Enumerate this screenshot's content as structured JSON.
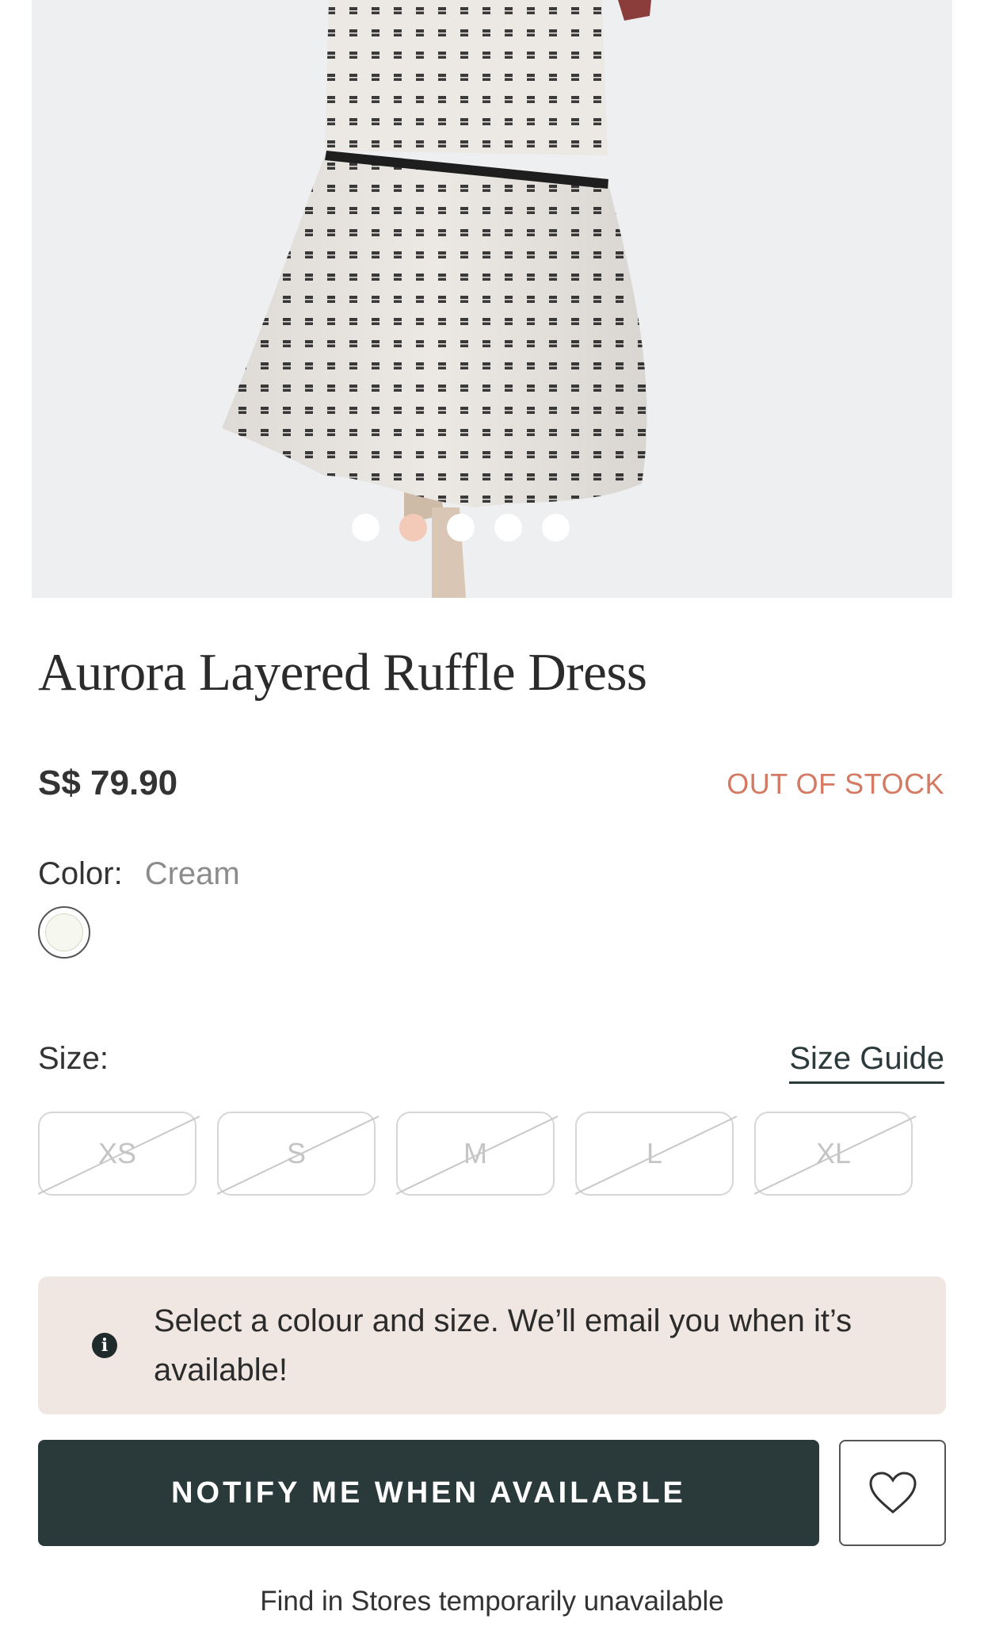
{
  "product": {
    "title": "Aurora Layered Ruffle Dress",
    "price": "S$ 79.90",
    "stock_status": "OUT OF STOCK",
    "image_count": 5,
    "active_image_index": 1
  },
  "color": {
    "label": "Color:",
    "selected": "Cream",
    "swatch_hex": "#f6f7ee"
  },
  "size": {
    "label": "Size:",
    "guide_label": "Size Guide",
    "options": [
      "XS",
      "S",
      "M",
      "L",
      "XL"
    ],
    "all_unavailable": true
  },
  "notice": {
    "icon": "info-icon",
    "text": "Select a colour and size. We’ll email you when it’s available!"
  },
  "actions": {
    "notify_label": "NOTIFY ME WHEN AVAILABLE",
    "wishlist_icon": "heart-icon"
  },
  "footer": {
    "stores_text": "Find in Stores temporarily unavailable"
  },
  "colors": {
    "accent_dark": "#2a3a3b",
    "out_of_stock": "#d47a63",
    "notice_bg": "#f1e7e2",
    "active_dot": "#f3c9b8"
  }
}
